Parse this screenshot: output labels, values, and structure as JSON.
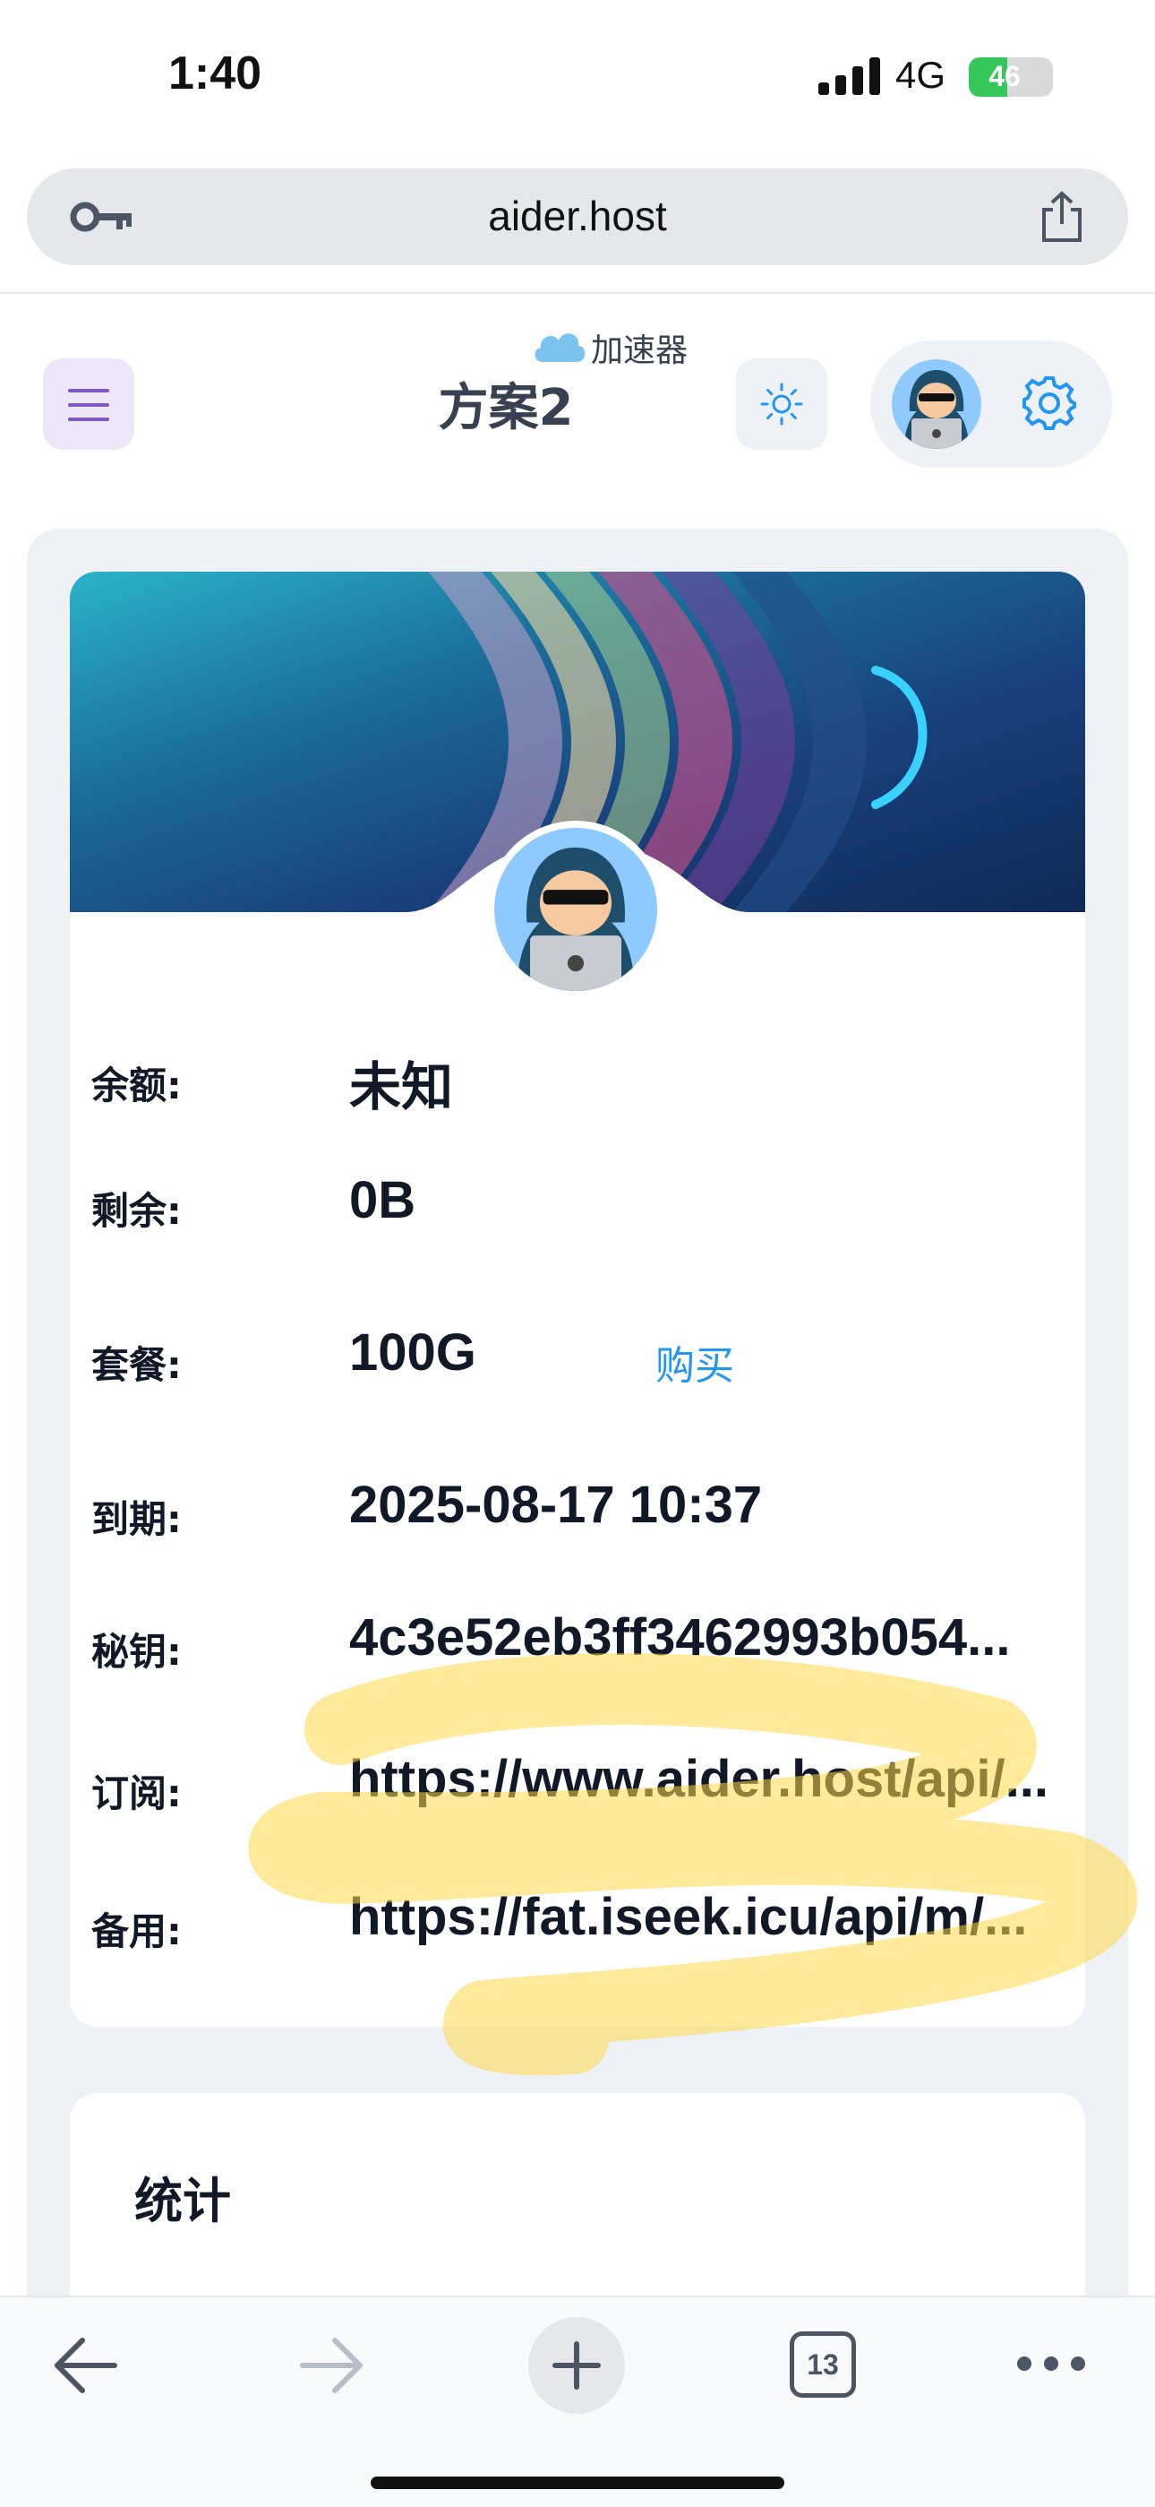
{
  "status_bar": {
    "time": "1:40",
    "network": "4G",
    "battery_level": "46",
    "battery_fraction": 0.46,
    "battery_color": "#34c759"
  },
  "browser": {
    "url": "aider.host",
    "icons": {
      "left": "key-icon",
      "right": "share-icon"
    }
  },
  "header": {
    "brand_icon": "cloud-icon",
    "brand": "加速器",
    "title": "方案2",
    "menu_icon": "hamburger-icon",
    "theme_icon": "sun-icon",
    "settings_icon": "gear-icon",
    "accent_color": "#2196f3"
  },
  "profile": {
    "rows": [
      {
        "label": "余额:",
        "value": "未知"
      },
      {
        "label": "剩余:",
        "value": "0B"
      },
      {
        "label": "套餐:",
        "value": "100G"
      },
      {
        "label": "到期:",
        "value": "2025-08-17 10:37"
      },
      {
        "label": "秘钥:",
        "value": "4c3e52eb3ff3462993b054..."
      },
      {
        "label": "订阅:",
        "value": "https://www.aider.host/api/..."
      },
      {
        "label": "备用:",
        "value": "https://fat.iseek.icu/api/m/..."
      }
    ],
    "buy_label": "购买",
    "buy_color": "#2196f3"
  },
  "stats": {
    "title": "统计"
  },
  "toolbar": {
    "tab_count": "13",
    "icons": [
      "back-arrow-icon",
      "forward-arrow-icon",
      "plus-icon",
      "tabs-icon",
      "more-icon"
    ]
  }
}
